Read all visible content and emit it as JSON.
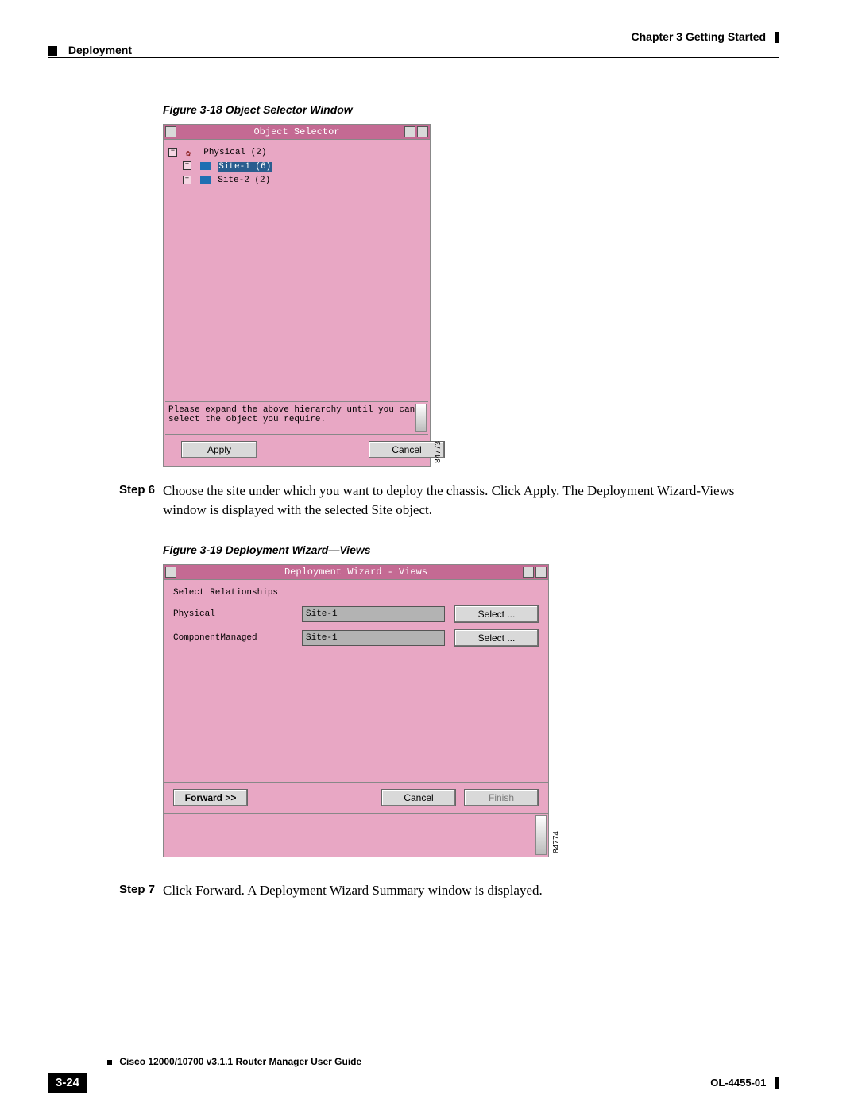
{
  "header": {
    "section": "Deployment",
    "chapter": "Chapter 3    Getting Started"
  },
  "figure1": {
    "caption": "Figure 3-18  Object Selector Window",
    "window_title": "Object Selector",
    "tree": {
      "root": "Physical (2)",
      "children": [
        {
          "label": "Site-1 (6)",
          "selected": true
        },
        {
          "label": "Site-2 (2)",
          "selected": false
        }
      ]
    },
    "message": "Please expand the above hierarchy until you can select the object you require.",
    "apply": "Apply",
    "cancel": "Cancel",
    "image_id": "84773"
  },
  "step6": {
    "label": "Step 6",
    "text": "Choose the site under which you want to deploy the chassis. Click Apply. The Deployment Wizard-Views window is displayed with the selected Site object."
  },
  "figure2": {
    "caption": "Figure 3-19  Deployment Wizard—Views",
    "window_title": "Deployment Wizard - Views",
    "group": "Select Relationships",
    "rows": [
      {
        "label": "Physical",
        "value": "Site-1",
        "btn": "Select ..."
      },
      {
        "label": "ComponentManaged",
        "value": "Site-1",
        "btn": "Select ..."
      }
    ],
    "forward": "Forward >>",
    "cancel": "Cancel",
    "finish": "Finish",
    "image_id": "84774"
  },
  "step7": {
    "label": "Step 7",
    "text": "Click Forward. A Deployment Wizard Summary window is displayed."
  },
  "footer": {
    "guide": "Cisco 12000/10700 v3.1.1 Router Manager User Guide",
    "page": "3-24",
    "doc": "OL-4455-01"
  }
}
